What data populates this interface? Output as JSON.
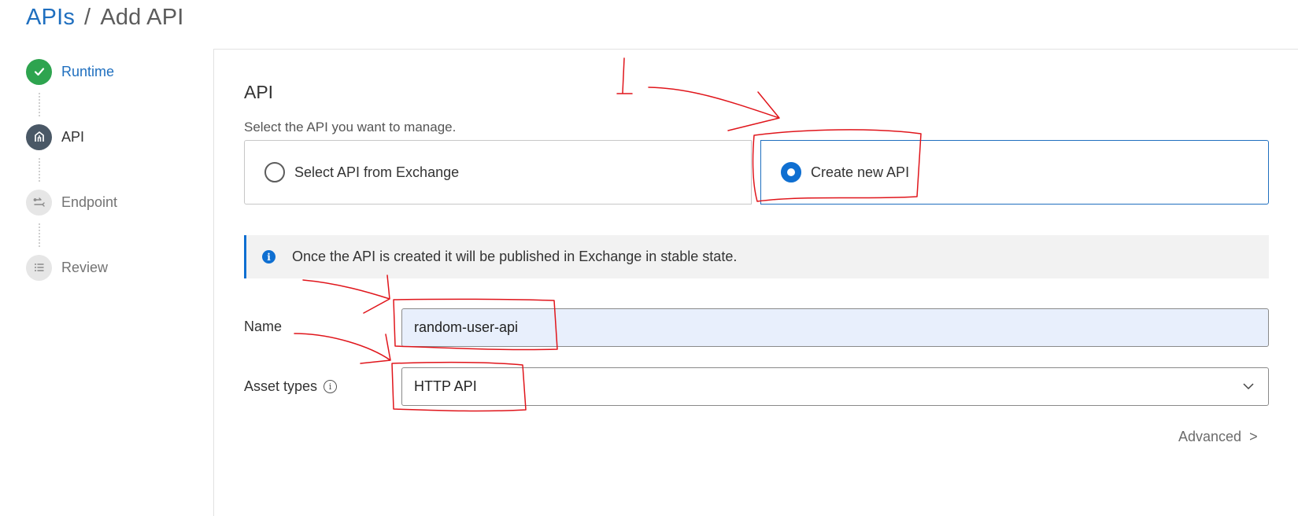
{
  "breadcrumb": {
    "parent": "APIs",
    "separator": "/",
    "current": "Add API"
  },
  "stepper": {
    "steps": [
      {
        "label": "Runtime",
        "state": "done",
        "icon": "check-icon"
      },
      {
        "label": "API",
        "state": "active",
        "icon": "api-icon"
      },
      {
        "label": "Endpoint",
        "state": "todo",
        "icon": "endpoint-icon"
      },
      {
        "label": "Review",
        "state": "todo",
        "icon": "list-icon"
      }
    ]
  },
  "main": {
    "section_title": "API",
    "section_subtitle": "Select the API you want to manage.",
    "options": [
      {
        "label": "Select API from Exchange",
        "selected": false
      },
      {
        "label": "Create new API",
        "selected": true
      }
    ],
    "info_banner": {
      "icon": "info-icon",
      "text": "Once the API is created it will be published in Exchange in stable state."
    },
    "name_field": {
      "label": "Name",
      "value": "random-user-api"
    },
    "asset_types_field": {
      "label": "Asset types",
      "tooltip_icon": "info-outline-icon",
      "value": "HTTP API"
    },
    "advanced": {
      "label": "Advanced",
      "suffix": ">"
    }
  },
  "annotations": {
    "number_label": "1",
    "stroke_color": "#e0151b"
  },
  "colors": {
    "accent": "#0f6fd1",
    "link": "#1f6fbf",
    "success": "#2ea44f",
    "active_step": "#4a5866"
  }
}
